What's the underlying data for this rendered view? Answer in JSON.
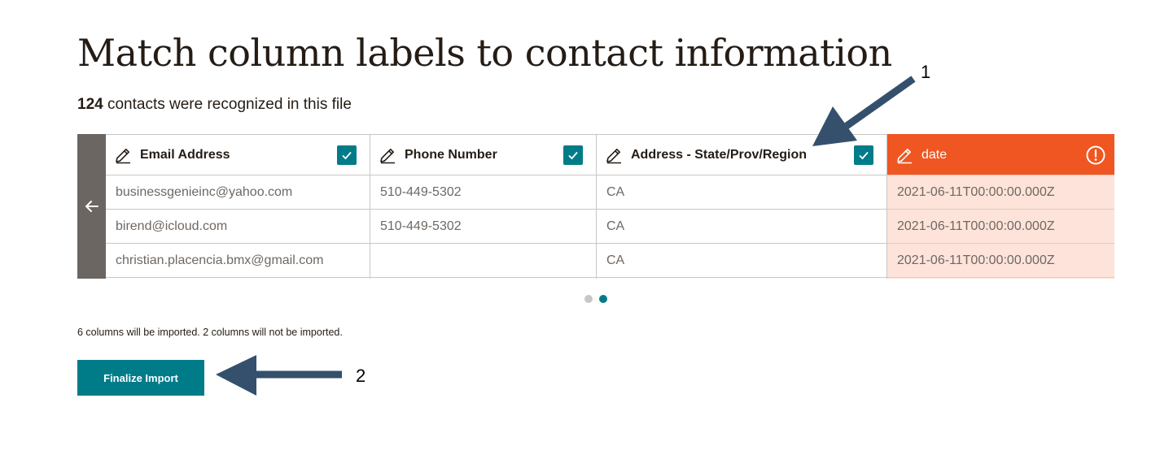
{
  "page": {
    "title": "Match column labels to contact information",
    "count": "124",
    "subtitle_rest": " contacts were recognized in this file"
  },
  "columns": [
    {
      "label": "Email Address",
      "status": "matched",
      "cells": [
        "businessgenieinc@yahoo.com",
        "birend@icloud.com",
        "christian.placencia.bmx@gmail.com"
      ]
    },
    {
      "label": "Phone Number",
      "status": "matched",
      "cells": [
        "510-449-5302",
        "510-449-5302",
        ""
      ]
    },
    {
      "label": "Address - State/Prov/Region",
      "status": "matched",
      "cells": [
        "CA",
        "CA",
        "CA"
      ]
    },
    {
      "label": "date",
      "status": "error",
      "cells": [
        "2021-06-11T00:00:00.000Z",
        "2021-06-11T00:00:00.000Z",
        "2021-06-11T00:00:00.000Z"
      ]
    }
  ],
  "pagination": {
    "pages": 2,
    "current": 2
  },
  "import_note": "6 columns will be imported. 2 columns will not be imported.",
  "finalize_label": "Finalize Import",
  "annotations": {
    "arrow1_label": "1",
    "arrow2_label": "2"
  },
  "icons": {
    "back": "arrow-left-icon",
    "edit": "pencil-icon",
    "matched": "checkmark-icon",
    "error": "alert-circle-icon"
  },
  "colors": {
    "accent": "#007c89",
    "error": "#f05622",
    "error_bg": "#fde3d9",
    "back_col": "#6b6662",
    "annotation_arrow": "#34506c"
  }
}
